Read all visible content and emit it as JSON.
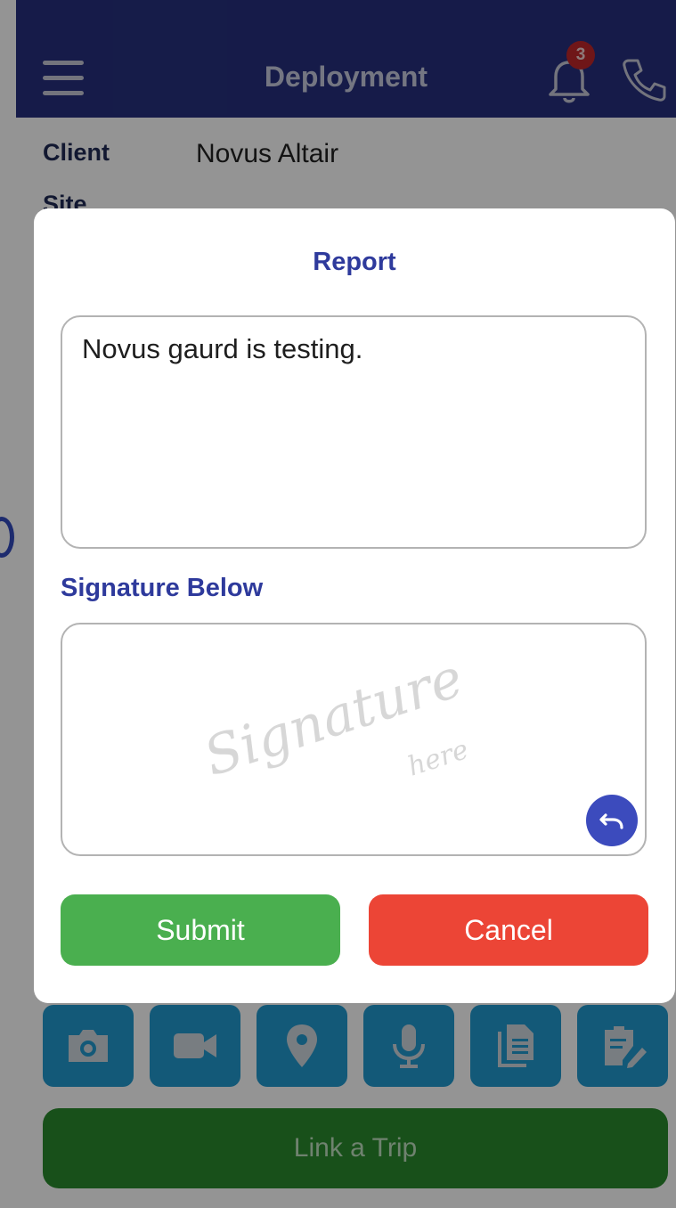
{
  "app_bar": {
    "title": "Deployment",
    "notification_count": "3",
    "icons": [
      "menu-icon",
      "bell-icon",
      "phone-icon"
    ],
    "background": "#26307e"
  },
  "details": {
    "client_label": "Client",
    "client_value": "Novus Altair",
    "site_label": "Site"
  },
  "actions": {
    "icons": [
      "camera-icon",
      "video-icon",
      "location-icon",
      "microphone-icon",
      "documents-icon",
      "clipboard-edit-icon"
    ],
    "link_trip_label": "Link a Trip"
  },
  "report_dialog": {
    "title": "Report",
    "report_text": "Novus gaurd is testing.",
    "signature_label": "Signature Below",
    "signature_placeholder_main": "Signature",
    "signature_placeholder_sub": "here",
    "undo_icon": "undo-icon",
    "submit_label": "Submit",
    "cancel_label": "Cancel",
    "colors": {
      "title": "#2e3a9c",
      "submit": "#4aaf4f",
      "cancel": "#ec4536",
      "undo": "#3c4bbd"
    }
  }
}
